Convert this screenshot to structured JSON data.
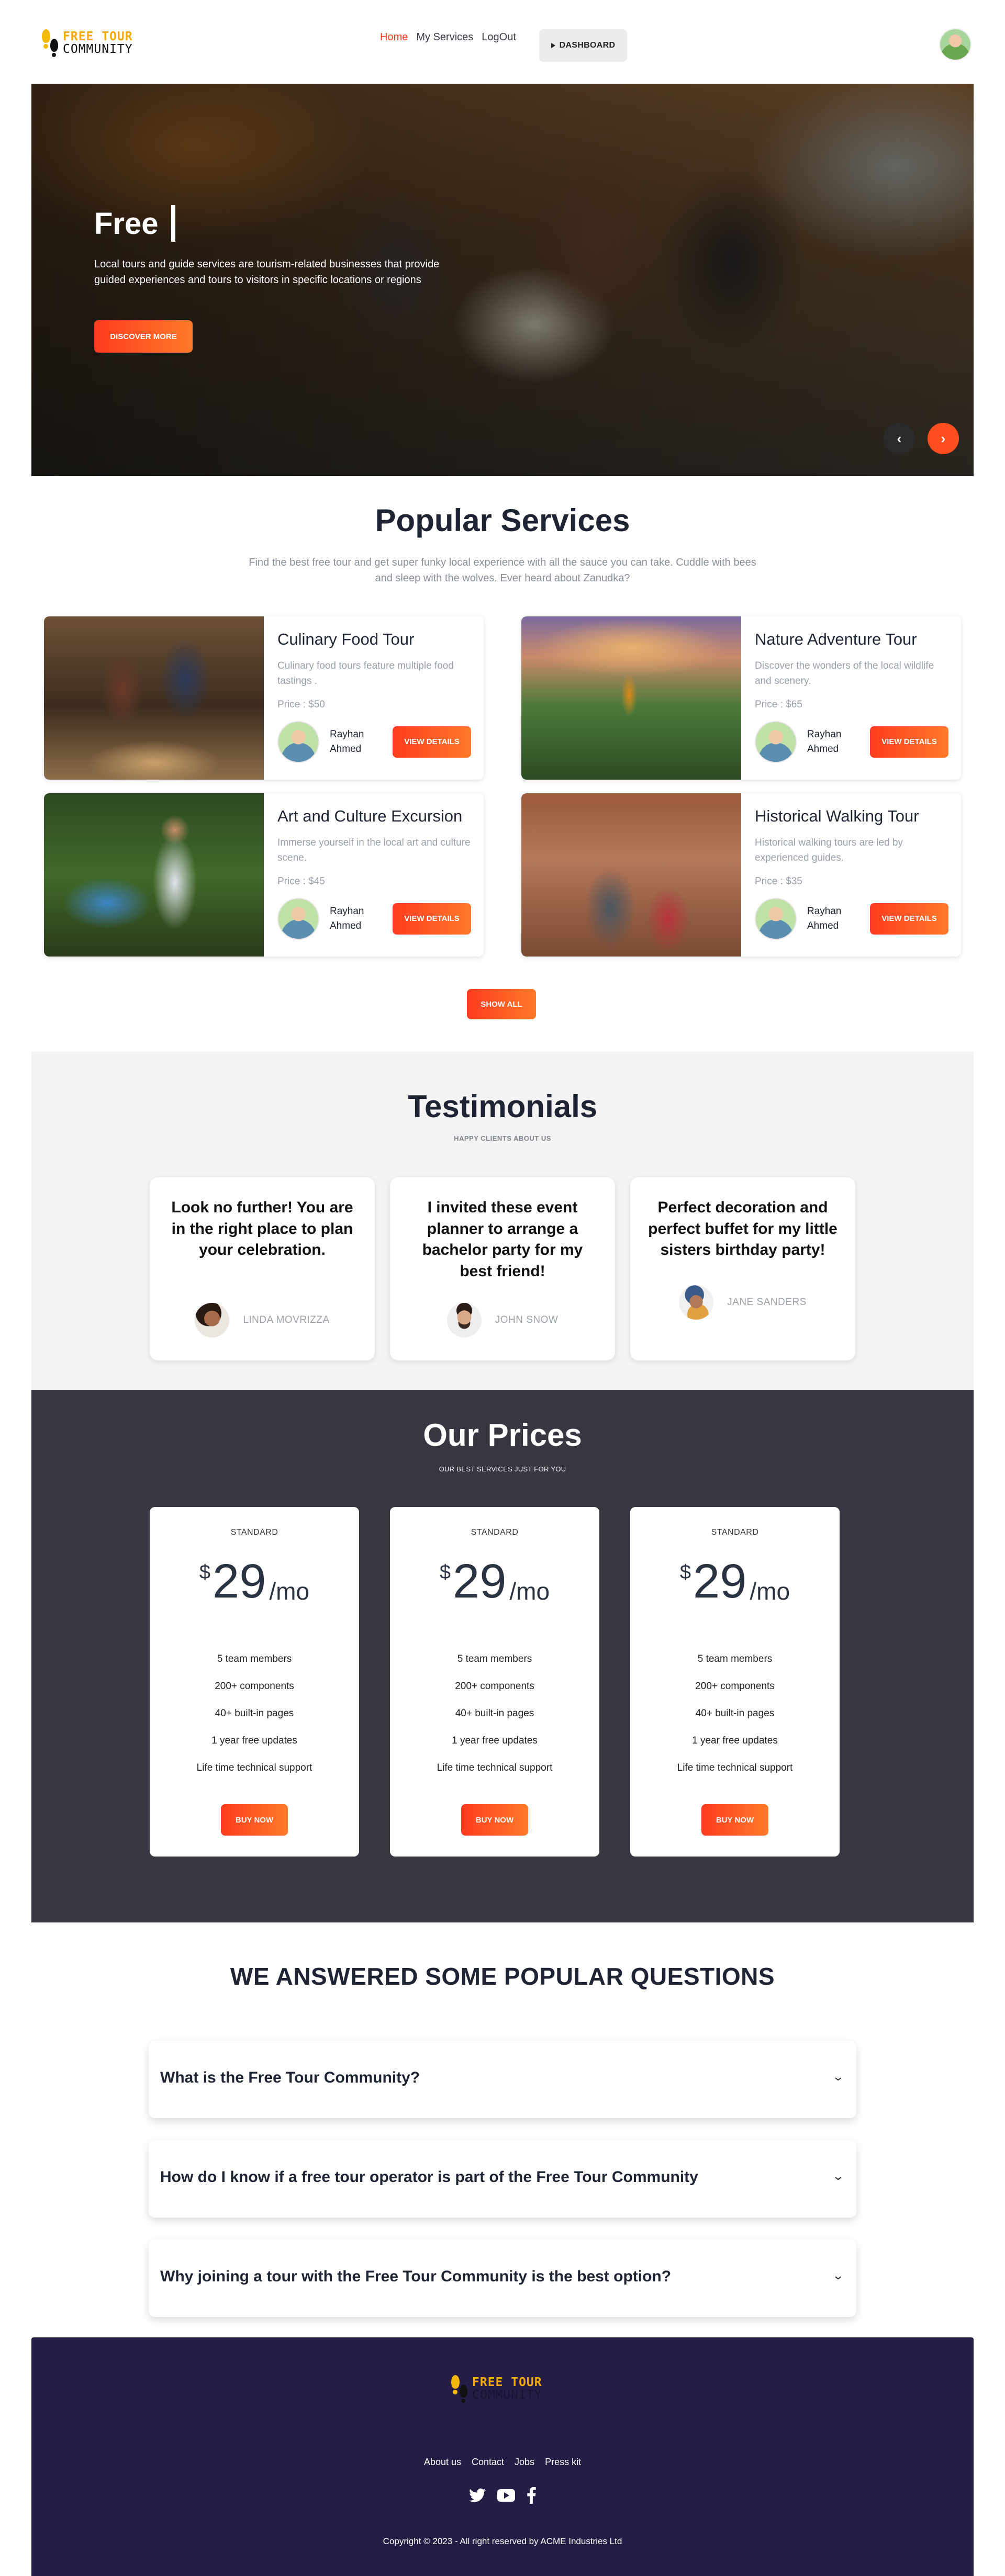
{
  "brand": {
    "line1": "FREE TOUR",
    "line2": "COMMUNITY"
  },
  "nav": {
    "links": [
      {
        "label": "Home",
        "active": true
      },
      {
        "label": "My Services",
        "active": false
      },
      {
        "label": "LogOut",
        "active": false
      }
    ],
    "dashboard_label": "DASHBOARD"
  },
  "hero": {
    "title": "Free",
    "description": "Local tours and guide services are tourism-related businesses that provide guided experiences and tours to visitors in specific locations or regions",
    "cta_label": "DISCOVER MORE",
    "prev_icon": "‹",
    "next_icon": "›"
  },
  "services": {
    "title": "Popular Services",
    "subtitle": "Find the best free tour and get super funky local experience with all the sauce you can take. Cuddle with bees and sleep with the wolves. Ever heard about Zanudka?",
    "items": [
      {
        "title": "Culinary Food Tour",
        "description": "Culinary food tours feature multiple food tastings .",
        "price": "Price : $50",
        "author": "Rayhan Ahmed",
        "button": "VIEW DETAILS"
      },
      {
        "title": "Nature Adventure Tour",
        "description": "Discover the wonders of the local wildlife and scenery.",
        "price": "Price : $65",
        "author": "Rayhan Ahmed",
        "button": "VIEW DETAILS"
      },
      {
        "title": "Art and Culture Excursion",
        "description": "Immerse yourself in the local art and culture scene.",
        "price": "Price : $45",
        "author": "Rayhan Ahmed",
        "button": "VIEW DETAILS"
      },
      {
        "title": "Historical Walking Tour",
        "description": "Historical walking tours are led by experienced guides.",
        "price": "Price : $35",
        "author": "Rayhan Ahmed",
        "button": "VIEW DETAILS"
      }
    ],
    "show_all": "SHOW ALL"
  },
  "testimonials": {
    "title": "Testimonials",
    "subtitle": "HAPPY CLIENTS ABOUT US",
    "items": [
      {
        "quote": "Look no further! You are in the right place to plan your celebration.",
        "name": "LINDA MOVRIZZA"
      },
      {
        "quote": "I invited these event planner to arrange a bachelor party for my best friend!",
        "name": "JOHN SNOW"
      },
      {
        "quote": "Perfect decoration and perfect buffet for my little sisters birthday party!",
        "name": "JANE SANDERS"
      }
    ]
  },
  "prices": {
    "title": "Our Prices",
    "subtitle": "OUR BEST SERVICES JUST FOR YOU",
    "plans": [
      {
        "label": "STANDARD",
        "currency": "$",
        "amount": "29",
        "period": "/mo",
        "features": [
          "5 team members",
          "200+ components",
          "40+ built-in pages",
          "1 year free updates",
          "Life time technical support"
        ],
        "button": "BUY NOW"
      },
      {
        "label": "STANDARD",
        "currency": "$",
        "amount": "29",
        "period": "/mo",
        "features": [
          "5 team members",
          "200+ components",
          "40+ built-in pages",
          "1 year free updates",
          "Life time technical support"
        ],
        "button": "BUY NOW"
      },
      {
        "label": "STANDARD",
        "currency": "$",
        "amount": "29",
        "period": "/mo",
        "features": [
          "5 team members",
          "200+ components",
          "40+ built-in pages",
          "1 year free updates",
          "Life time technical support"
        ],
        "button": "BUY NOW"
      }
    ]
  },
  "faq": {
    "title": "WE ANSWERED SOME POPULAR QUESTIONS",
    "items": [
      {
        "question": "What is the Free Tour Community?"
      },
      {
        "question": "How do I know if a free tour operator is part of the Free Tour Community"
      },
      {
        "question": "Why joining a tour with the Free Tour Community is the best option?"
      }
    ],
    "chevron_icon": "⌄"
  },
  "footer": {
    "links": [
      "About us",
      "Contact",
      "Jobs",
      "Press kit"
    ],
    "social_icons": [
      "twitter-icon",
      "youtube-icon",
      "facebook-icon"
    ],
    "copyright": "Copyright © 2023 - All right reserved by ACME Industries Ltd"
  },
  "colors": {
    "accent": "#ff3d24",
    "brand_yellow": "#f5a90a",
    "prices_bg": "#383640",
    "footer_bg": "#261d47"
  }
}
